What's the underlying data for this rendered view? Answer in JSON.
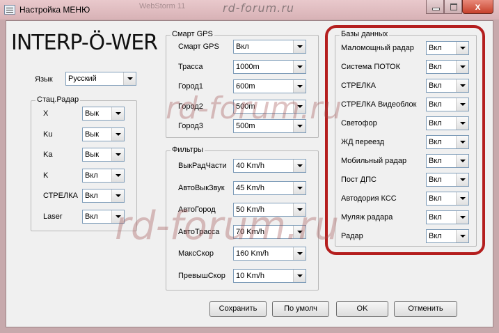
{
  "window": {
    "title": "Настройка МЕНЮ",
    "close_glyph": "x",
    "ghost_title": "WebStorm 11"
  },
  "logo": {
    "text": "INTERP-Ö-WER"
  },
  "language": {
    "label": "Язык",
    "value": "Русский"
  },
  "stat_radar": {
    "legend": "Стац.Радар",
    "rows": [
      {
        "label": "X",
        "value": "Вык"
      },
      {
        "label": "Ku",
        "value": "Вык"
      },
      {
        "label": "Ka",
        "value": "Вык"
      },
      {
        "label": "K",
        "value": "Вкл"
      },
      {
        "label": "СТРЕЛКА",
        "value": "Вкл"
      },
      {
        "label": "Laser",
        "value": "Вкл"
      }
    ]
  },
  "smart_gps": {
    "legend": "Смарт GPS",
    "rows": [
      {
        "label": "Смарт GPS",
        "value": "Вкл"
      },
      {
        "label": "Трасса",
        "value": "1000m"
      },
      {
        "label": "Город1",
        "value": "600m"
      },
      {
        "label": "Город2",
        "value": "500m"
      },
      {
        "label": "Город3",
        "value": "500m"
      }
    ]
  },
  "filters": {
    "legend": "Фильтры",
    "rows": [
      {
        "label": "ВыкРадЧасти",
        "value": "40 Km/h"
      },
      {
        "label": "АвтоВыкЗвук",
        "value": "45 Km/h"
      },
      {
        "label": "АвтоГород",
        "value": "50 Km/h"
      },
      {
        "label": "АвтоТрасса",
        "value": "70 Km/h"
      },
      {
        "label": "МаксСкор",
        "value": "160 Km/h"
      },
      {
        "label": "ПревышСкор",
        "value": "10 Km/h"
      }
    ]
  },
  "databases": {
    "legend": "Базы данных",
    "rows": [
      {
        "label": "Маломощный радар",
        "value": "Вкл"
      },
      {
        "label": "Система ПОТОК",
        "value": "Вкл"
      },
      {
        "label": "СТРЕЛКА",
        "value": "Вкл"
      },
      {
        "label": "СТРЕЛКА Видеоблок",
        "value": "Вкл"
      },
      {
        "label": "Светофор",
        "value": "Вкл"
      },
      {
        "label": "ЖД переезд",
        "value": "Вкл"
      },
      {
        "label": "Мобильный радар",
        "value": "Вкл"
      },
      {
        "label": "Пост ДПС",
        "value": "Вкл"
      },
      {
        "label": "Автодория КСС",
        "value": "Вкл"
      },
      {
        "label": "Муляж радара",
        "value": "Вкл"
      },
      {
        "label": "Радар",
        "value": "Вкл"
      }
    ]
  },
  "buttons": {
    "save": "Сохранить",
    "default": "По умолч",
    "ok": "OK",
    "cancel": "Отменить"
  },
  "watermark": "rd-forum.ru",
  "colors": {
    "highlight": "#b41e1e",
    "close": "#c7412c"
  }
}
